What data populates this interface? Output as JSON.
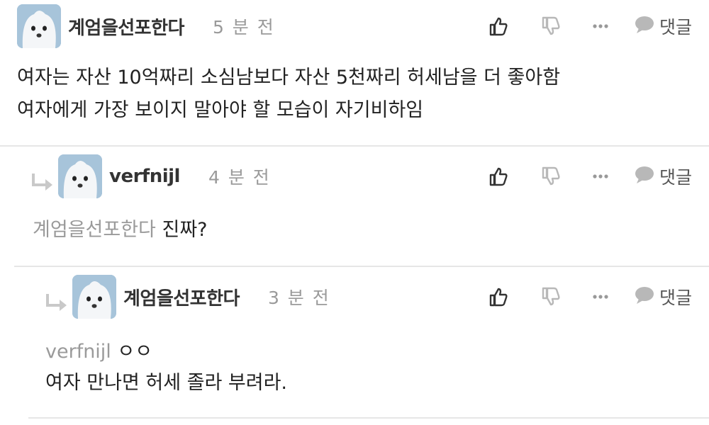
{
  "comments": [
    {
      "author": "계엄을선포한다",
      "time": "5 분 전",
      "lines": [
        "여자는 자산 10억짜리 소심남보다 자산 5천짜리 허세남을 더 좋아함",
        "여자에게 가장 보이지 말아야 할 모습이 자기비하임"
      ],
      "reply_label": "댓글"
    },
    {
      "author": "verfnijl",
      "time": "4 분 전",
      "mention": "계엄을선포한다",
      "text": "진짜?",
      "reply_label": "댓글"
    },
    {
      "author": "계엄을선포한다",
      "time": "3 분 전",
      "mention": "verfnijl",
      "text_first": "ㅇㅇ",
      "text_second": "여자 만나면 허세 졸라 부려라.",
      "reply_label": "댓글"
    }
  ],
  "icons": {
    "like": "thumbs-up-icon",
    "dislike": "thumbs-down-icon",
    "more": "more-dots-icon",
    "reply": "speech-bubble-icon",
    "reply_indent": "reply-arrow-icon"
  },
  "colors": {
    "text": "#222222",
    "muted": "#9a9a9a",
    "divider": "#e6e6e6",
    "icon_dark": "#333333",
    "icon_light": "#b8b8b8"
  }
}
